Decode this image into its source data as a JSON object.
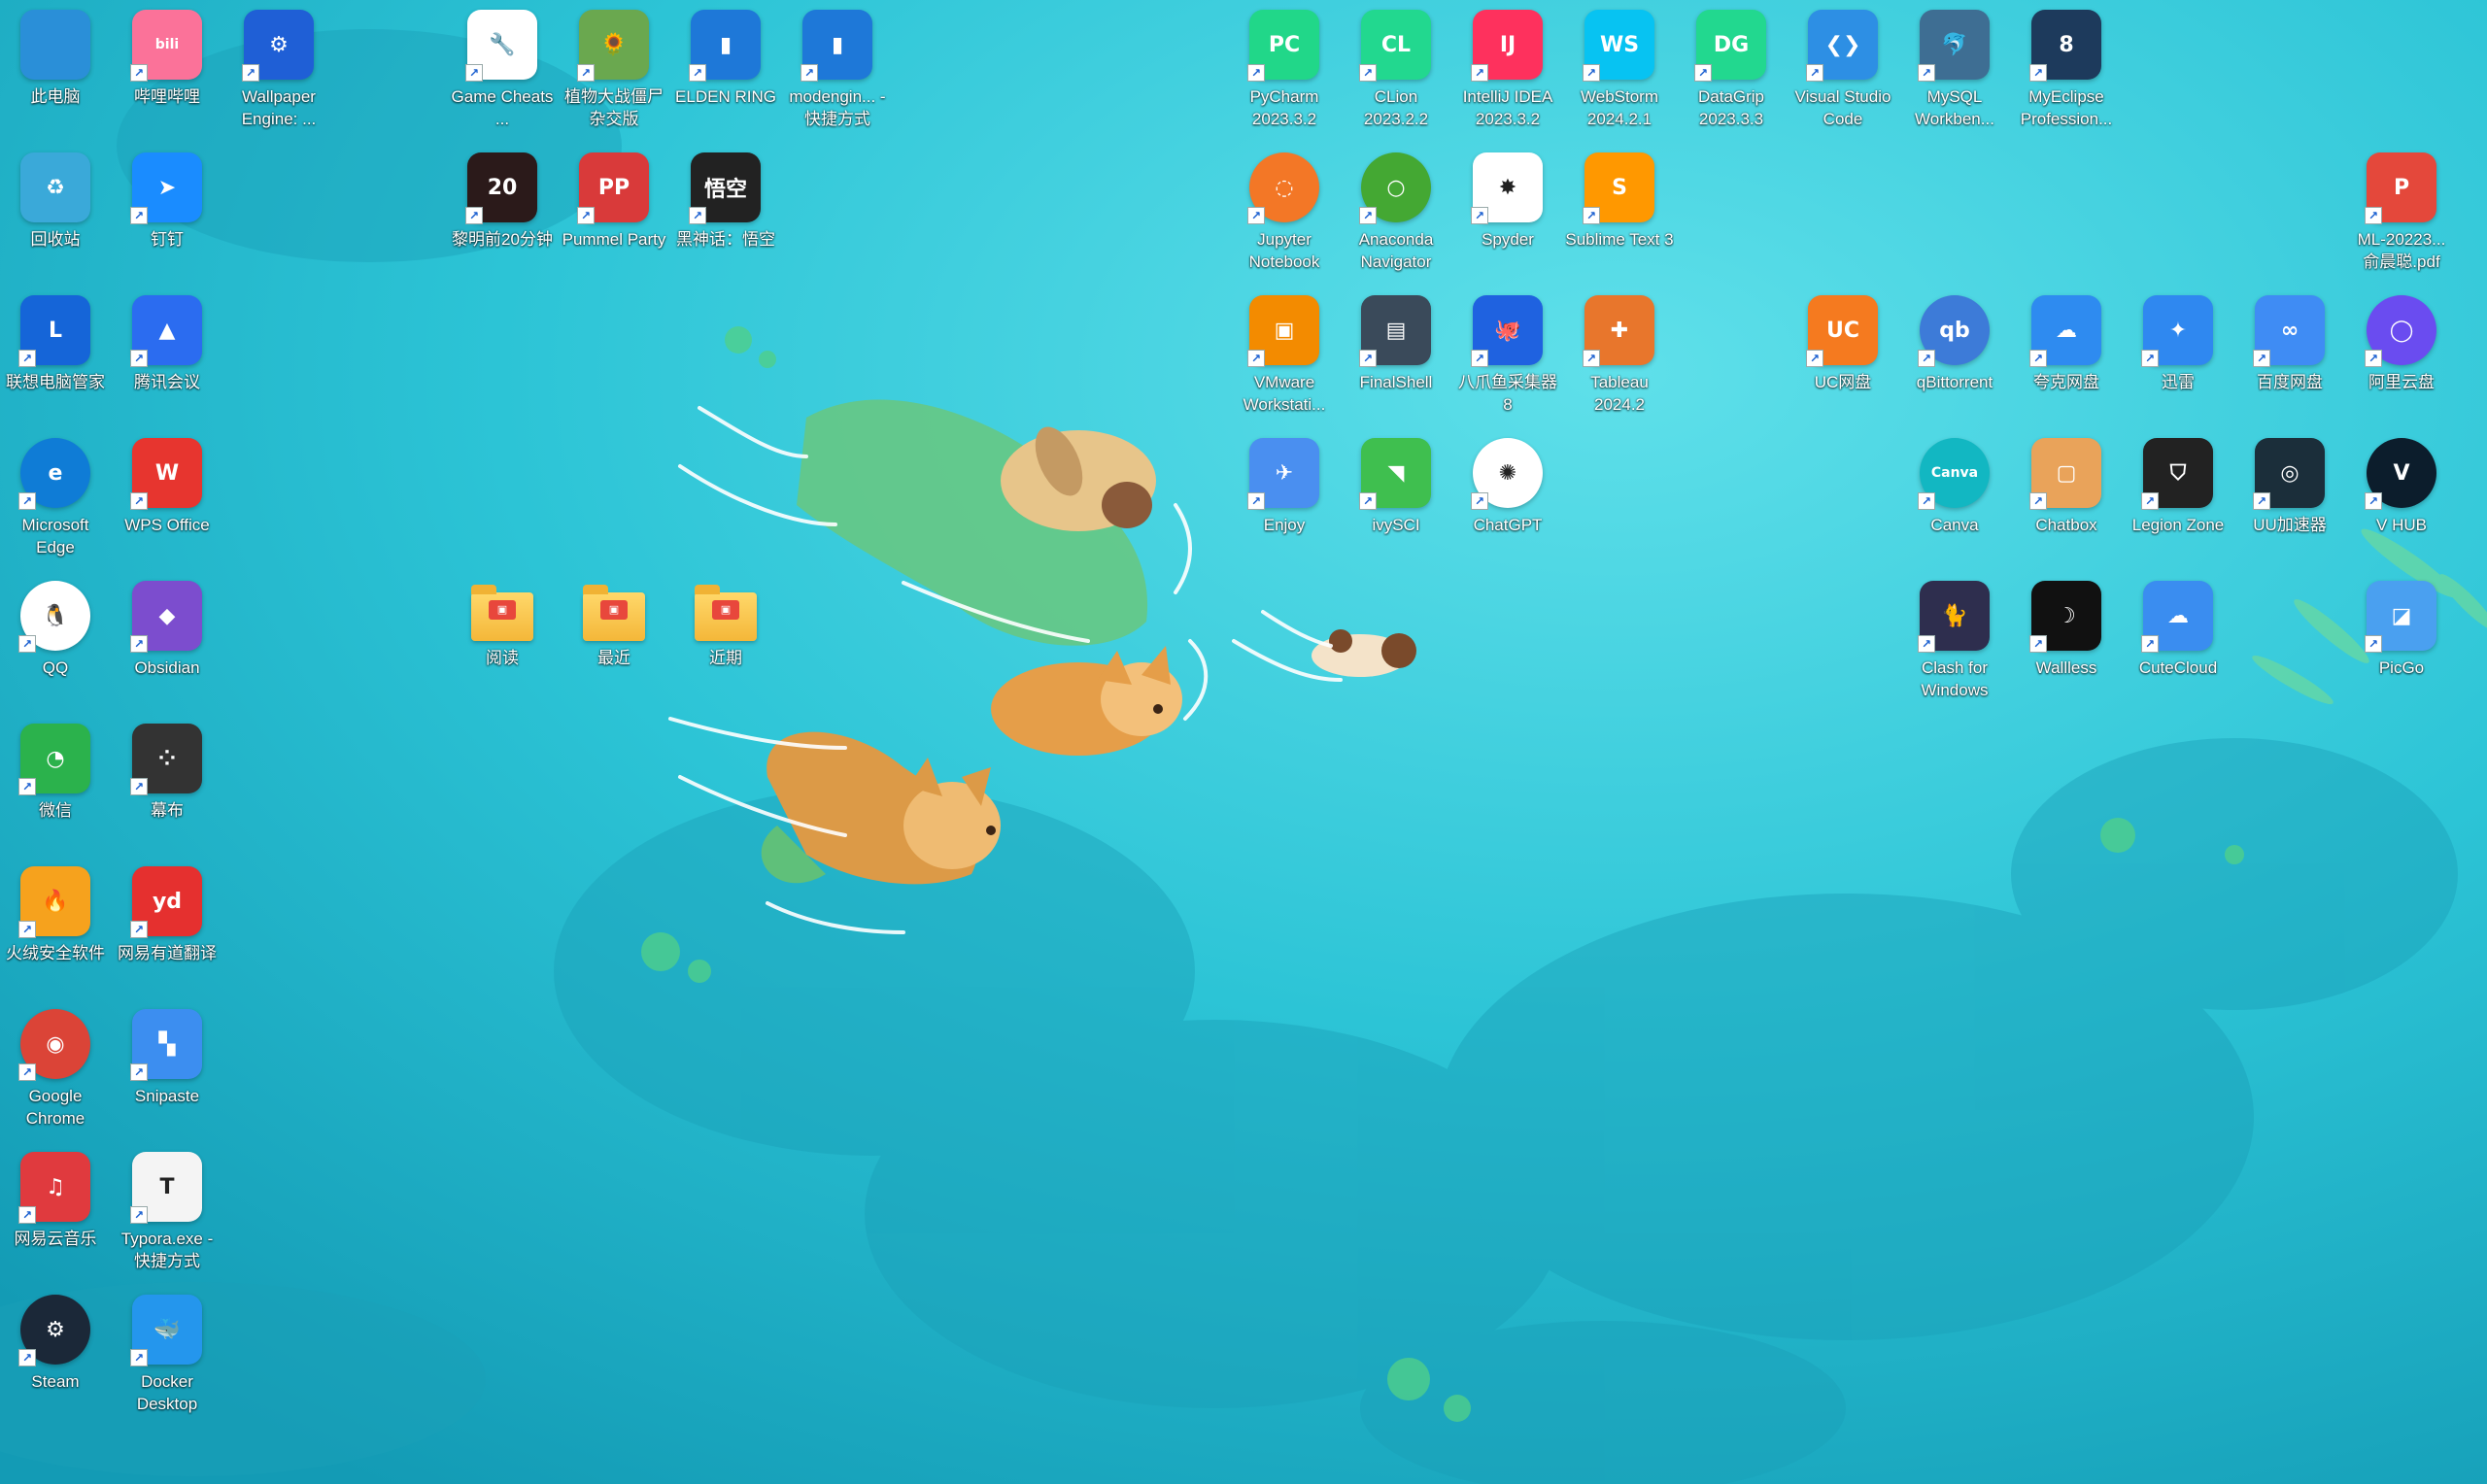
{
  "desktop": {
    "icons": [
      {
        "label": "此电脑",
        "glyph": "",
        "color": "#2a8fd8",
        "icon": "computer-icon"
      },
      {
        "label": "哔哩哔哩",
        "glyph": "bili",
        "color": "#fb7299",
        "icon": "bilibili-icon"
      },
      {
        "label": "Wallpaper Engine: ...",
        "glyph": "⚙",
        "color": "#1f5fd6",
        "icon": "wallpaper-engine-icon"
      },
      {
        "label": "回收站",
        "glyph": "♻",
        "color": "#3aa9d9",
        "icon": "recycle-bin-icon"
      },
      {
        "label": "钉钉",
        "glyph": "➤",
        "color": "#1a8cff",
        "icon": "dingtalk-icon"
      },
      {
        "label": "联想电脑管家",
        "glyph": "L",
        "color": "#1565d8",
        "icon": "lenovo-manager-icon"
      },
      {
        "label": "腾讯会议",
        "glyph": "▲",
        "color": "#2b6cf0",
        "icon": "tencent-meeting-icon"
      },
      {
        "label": "Microsoft Edge",
        "glyph": "e",
        "color": "#0f7cd6",
        "icon": "edge-icon"
      },
      {
        "label": "WPS Office",
        "glyph": "W",
        "color": "#e7352f",
        "icon": "wps-icon"
      },
      {
        "label": "QQ",
        "glyph": "🐧",
        "color": "#ffffff",
        "icon": "qq-icon"
      },
      {
        "label": "Obsidian",
        "glyph": "◆",
        "color": "#7c4dce",
        "icon": "obsidian-icon"
      },
      {
        "label": "微信",
        "glyph": "◔",
        "color": "#2bb24c",
        "icon": "wechat-icon"
      },
      {
        "label": "幕布",
        "glyph": "⁘",
        "color": "#333333",
        "icon": "mubu-icon"
      },
      {
        "label": "火绒安全软件",
        "glyph": "🔥",
        "color": "#f6a21d",
        "icon": "huorong-icon"
      },
      {
        "label": "网易有道翻译",
        "glyph": "yd",
        "color": "#e5302f",
        "icon": "youdao-icon"
      },
      {
        "label": "Google Chrome",
        "glyph": "◉",
        "color": "#db4437",
        "icon": "chrome-icon"
      },
      {
        "label": "Snipaste",
        "glyph": "▚",
        "color": "#3c8ef0",
        "icon": "snipaste-icon"
      },
      {
        "label": "网易云音乐",
        "glyph": "♫",
        "color": "#e03a3e",
        "icon": "netease-music-icon"
      },
      {
        "label": "Typora.exe - 快捷方式",
        "glyph": "T",
        "color": "#f4f4f4",
        "icon": "typora-icon"
      },
      {
        "label": "Steam",
        "glyph": "⚙",
        "color": "#1b2838",
        "icon": "steam-icon"
      },
      {
        "label": "Docker Desktop",
        "glyph": "🐳",
        "color": "#2496ed",
        "icon": "docker-icon"
      },
      {
        "label": "Game Cheats ...",
        "glyph": "🔧",
        "color": "#ffffff",
        "icon": "game-cheats-icon"
      },
      {
        "label": "植物大战僵尸杂交版",
        "glyph": "🌻",
        "color": "#6aa84f",
        "icon": "pvz-icon"
      },
      {
        "label": "ELDEN RING",
        "glyph": "▮",
        "color": "#1e78d8",
        "icon": "elden-ring-icon"
      },
      {
        "label": "modengin... - 快捷方式",
        "glyph": "▮",
        "color": "#1e78d8",
        "icon": "modengine-icon"
      },
      {
        "label": "黎明前20分钟",
        "glyph": "20",
        "color": "#2b1a1a",
        "icon": "20-minutes-icon"
      },
      {
        "label": "Pummel Party",
        "glyph": "PP",
        "color": "#d93a3a",
        "icon": "pummel-party-icon"
      },
      {
        "label": "黑神话：悟空",
        "glyph": "悟空",
        "color": "#222222",
        "icon": "black-myth-icon"
      },
      {
        "label": "阅读",
        "glyph": "",
        "color": "#f4b739",
        "icon": "folder-icon"
      },
      {
        "label": "最近",
        "glyph": "",
        "color": "#f4b739",
        "icon": "folder-icon"
      },
      {
        "label": "近期",
        "glyph": "",
        "color": "#f4b739",
        "icon": "folder-icon"
      },
      {
        "label": "PyCharm 2023.3.2",
        "glyph": "PC",
        "color": "#21d789",
        "icon": "pycharm-icon"
      },
      {
        "label": "CLion 2023.2.2",
        "glyph": "CL",
        "color": "#22d88f",
        "icon": "clion-icon"
      },
      {
        "label": "IntelliJ IDEA 2023.3.2",
        "glyph": "IJ",
        "color": "#fe315d",
        "icon": "intellij-icon"
      },
      {
        "label": "WebStorm 2024.2.1",
        "glyph": "WS",
        "color": "#07c3f2",
        "icon": "webstorm-icon"
      },
      {
        "label": "DataGrip 2023.3.3",
        "glyph": "DG",
        "color": "#22d88f",
        "icon": "datagrip-icon"
      },
      {
        "label": "Visual Studio Code",
        "glyph": "❮❯",
        "color": "#2d8fe4",
        "icon": "vscode-icon"
      },
      {
        "label": "MySQL Workben...",
        "glyph": "🐬",
        "color": "#3e6e93",
        "icon": "mysql-workbench-icon"
      },
      {
        "label": "MyEclipse Profession...",
        "glyph": "8",
        "color": "#1d3a5c",
        "icon": "myeclipse-icon"
      },
      {
        "label": "Jupyter Notebook",
        "glyph": "◌",
        "color": "#f37726",
        "icon": "jupyter-icon"
      },
      {
        "label": "Anaconda Navigator",
        "glyph": "○",
        "color": "#44a833",
        "icon": "anaconda-icon"
      },
      {
        "label": "Spyder",
        "glyph": "✸",
        "color": "#ffffff",
        "icon": "spyder-icon"
      },
      {
        "label": "Sublime Text 3",
        "glyph": "S",
        "color": "#ff9800",
        "icon": "sublime-icon"
      },
      {
        "label": "VMware Workstati...",
        "glyph": "▣",
        "color": "#f38b00",
        "icon": "vmware-icon"
      },
      {
        "label": "FinalShell",
        "glyph": "▤",
        "color": "#3a4a5a",
        "icon": "finalshell-icon"
      },
      {
        "label": "八爪鱼采集器 8",
        "glyph": "🐙",
        "color": "#1f62e0",
        "icon": "octoparse-icon"
      },
      {
        "label": "Tableau 2024.2",
        "glyph": "✚",
        "color": "#e8762c",
        "icon": "tableau-icon"
      },
      {
        "label": "Enjoy",
        "glyph": "✈",
        "color": "#4a8ff0",
        "icon": "enjoy-icon"
      },
      {
        "label": "ivySCI",
        "glyph": "◥",
        "color": "#3fbf4f",
        "icon": "ivysci-icon"
      },
      {
        "label": "ChatGPT",
        "glyph": "✺",
        "color": "#ffffff",
        "icon": "chatgpt-icon"
      },
      {
        "label": "ML-20223... 俞晨聪.pdf",
        "glyph": "P",
        "color": "#e4483b",
        "icon": "pdf-icon"
      },
      {
        "label": "UC网盘",
        "glyph": "UC",
        "color": "#f57a1f",
        "icon": "uc-drive-icon"
      },
      {
        "label": "qBittorrent",
        "glyph": "qb",
        "color": "#3d7bd8",
        "icon": "qbittorrent-icon"
      },
      {
        "label": "夸克网盘",
        "glyph": "☁",
        "color": "#2e8bf0",
        "icon": "quark-drive-icon"
      },
      {
        "label": "迅雷",
        "glyph": "✦",
        "color": "#2f88f0",
        "icon": "thunder-icon"
      },
      {
        "label": "百度网盘",
        "glyph": "∞",
        "color": "#3f8cf4",
        "icon": "baidu-drive-icon"
      },
      {
        "label": "阿里云盘",
        "glyph": "◯",
        "color": "#6a4cf0",
        "icon": "aliyun-drive-icon"
      },
      {
        "label": "Canva",
        "glyph": "Canva",
        "color": "#12b7c2",
        "icon": "canva-icon"
      },
      {
        "label": "Chatbox",
        "glyph": "▢",
        "color": "#e9a35a",
        "icon": "chatbox-icon"
      },
      {
        "label": "Legion Zone",
        "glyph": "⛉",
        "color": "#222222",
        "icon": "legion-zone-icon"
      },
      {
        "label": "UU加速器",
        "glyph": "◎",
        "color": "#1b2e3a",
        "icon": "uu-accelerator-icon"
      },
      {
        "label": "V HUB",
        "glyph": "V",
        "color": "#0c1d2c",
        "icon": "vhub-icon"
      },
      {
        "label": "Clash for Windows",
        "glyph": "🐈",
        "color": "#2e2e4e",
        "icon": "clash-icon"
      },
      {
        "label": "Wallless",
        "glyph": "☽",
        "color": "#111111",
        "icon": "wallless-icon"
      },
      {
        "label": "CuteCloud",
        "glyph": "☁",
        "color": "#3a8df0",
        "icon": "cutecloud-icon"
      },
      {
        "label": "PicGo",
        "glyph": "◪",
        "color": "#4aa0f0",
        "icon": "picgo-icon"
      }
    ]
  }
}
